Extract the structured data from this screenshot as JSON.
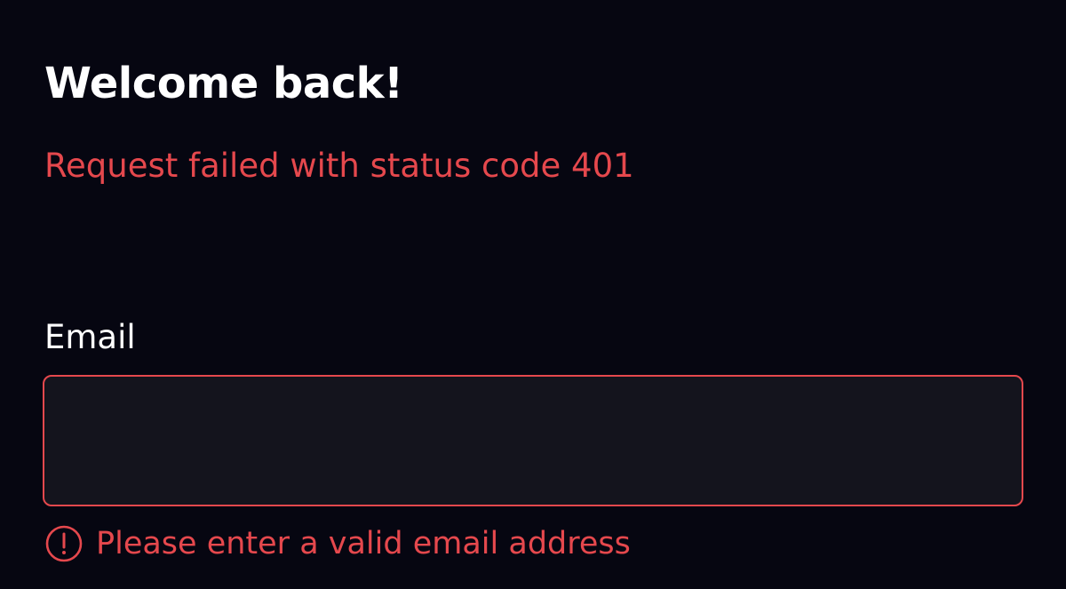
{
  "page": {
    "title": "Welcome back!",
    "request_error": "Request failed with status code 401"
  },
  "form": {
    "email": {
      "label": "Email",
      "value": "",
      "placeholder": "",
      "error": "Please enter a valid email address",
      "error_icon": "alert-circle-icon"
    }
  },
  "colors": {
    "background": "#060611",
    "error": "#e5484d",
    "input_background": "#14141d",
    "text": "#ffffff"
  }
}
